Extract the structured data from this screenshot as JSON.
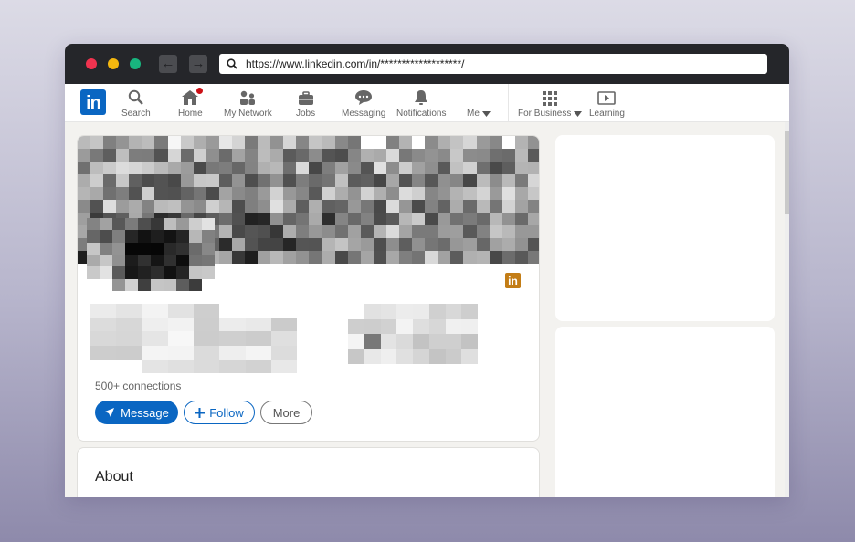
{
  "browser": {
    "url": "https://www.linkedin.com/in/*******************/"
  },
  "nav": {
    "logo_text": "in",
    "items": [
      {
        "label": "Search",
        "icon": "search-icon"
      },
      {
        "label": "Home",
        "icon": "home-icon"
      },
      {
        "label": "My Network",
        "icon": "network-icon"
      },
      {
        "label": "Jobs",
        "icon": "briefcase-icon"
      },
      {
        "label": "Messaging",
        "icon": "messaging-icon"
      },
      {
        "label": "Notifications",
        "icon": "bell-icon"
      },
      {
        "label": "Me",
        "icon": "chevron-down-icon"
      },
      {
        "label": "For Business",
        "icon": "grid-icon"
      },
      {
        "label": "Learning",
        "icon": "play-icon"
      }
    ]
  },
  "profile": {
    "linkedin_badge": "in",
    "connections": "500+ connections",
    "buttons": {
      "message": "Message",
      "follow": "Follow",
      "more": "More"
    }
  },
  "about": {
    "title": "About"
  },
  "colors": {
    "brand": "#0a66c2",
    "notification_badge": "#cc1016",
    "premium_badge": "#c37d16"
  }
}
